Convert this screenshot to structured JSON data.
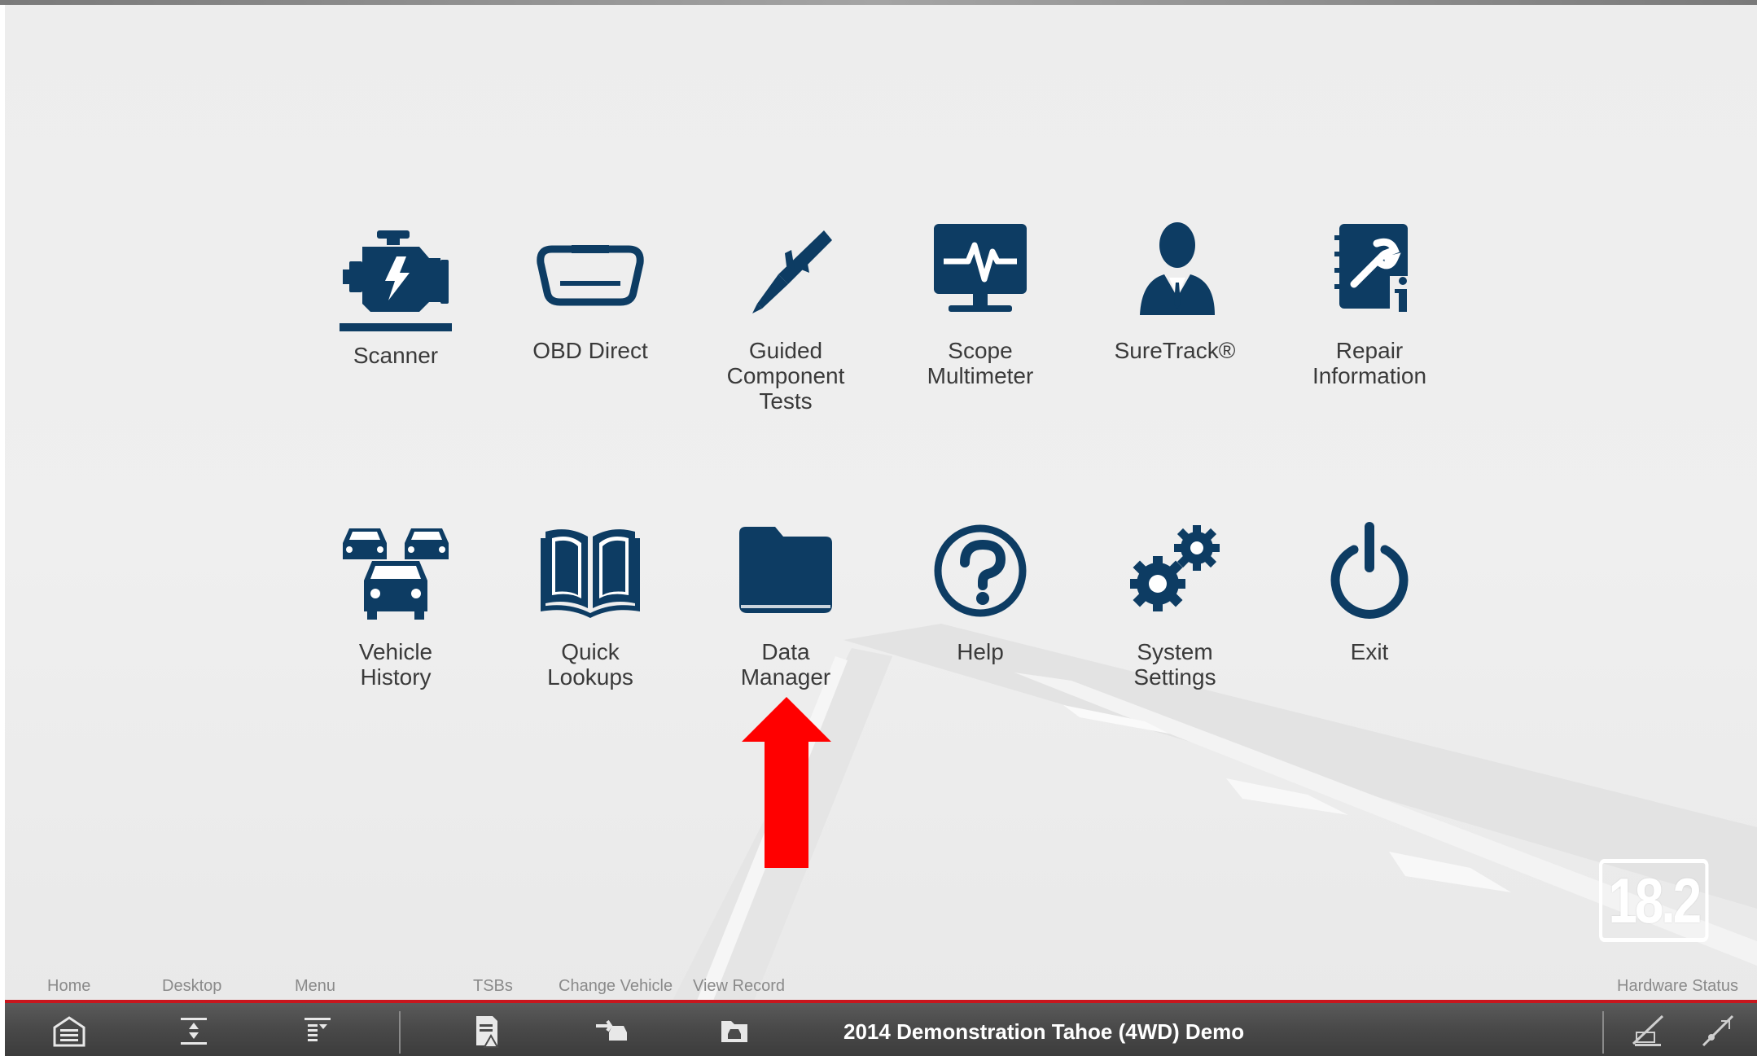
{
  "tiles": [
    {
      "label": "Scanner",
      "icon": "engine-icon"
    },
    {
      "label": "OBD Direct",
      "icon": "obd-connector-icon"
    },
    {
      "label": "Guided\nComponent\nTests",
      "icon": "probe-icon"
    },
    {
      "label": "Scope\nMultimeter",
      "icon": "scope-monitor-icon"
    },
    {
      "label": "SureTrack®",
      "icon": "technician-icon"
    },
    {
      "label": "Repair\nInformation",
      "icon": "repair-info-icon"
    },
    {
      "label": "Vehicle\nHistory",
      "icon": "cars-icon"
    },
    {
      "label": "Quick\nLookups",
      "icon": "book-icon"
    },
    {
      "label": "Data\nManager",
      "icon": "folder-icon"
    },
    {
      "label": "Help",
      "icon": "help-icon"
    },
    {
      "label": "System\nSettings",
      "icon": "gears-icon"
    },
    {
      "label": "Exit",
      "icon": "power-icon"
    }
  ],
  "version": "18.2",
  "toolbar": {
    "home": "Home",
    "desktop": "Desktop",
    "menu": "Menu",
    "tsbs": "TSBs",
    "change_vehicle": "Change Vehicle",
    "view_record": "View Record",
    "hardware_status": "Hardware Status"
  },
  "vehicle": "2014 Demonstration Tahoe (4WD) Demo",
  "colors": {
    "icon": "#0d3c63",
    "accent_red": "#c8161d",
    "arrow": "#ff0000"
  }
}
